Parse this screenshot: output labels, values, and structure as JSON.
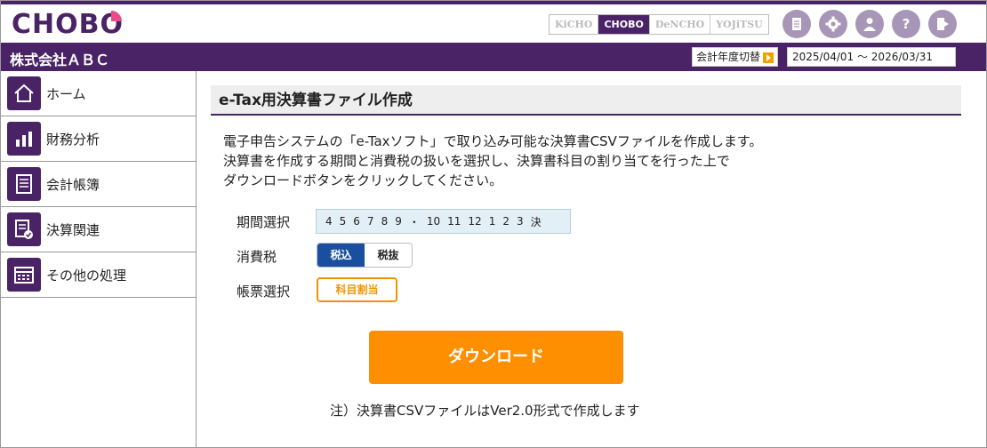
{
  "header": {
    "logo": "CHOBO",
    "apps": [
      "KiCHO",
      "CHOBO",
      "DeNCHO",
      "YOJiTSU"
    ],
    "active_app": "CHOBO",
    "icons": [
      "document-icon",
      "gear-icon",
      "user-icon",
      "help-icon",
      "logout-icon"
    ]
  },
  "band": {
    "company": "株式会社ＡＢＣ",
    "fy_switch_label": "会計年度切替",
    "fy_range": "2025/04/01 ～ 2026/03/31"
  },
  "sidebar": {
    "items": [
      {
        "label": "ホーム",
        "icon": "home-icon"
      },
      {
        "label": "財務分析",
        "icon": "bar-chart-icon"
      },
      {
        "label": "会計帳簿",
        "icon": "ledger-icon"
      },
      {
        "label": "決算関連",
        "icon": "settlement-icon"
      },
      {
        "label": "その他の処理",
        "icon": "calendar-icon"
      }
    ]
  },
  "main": {
    "title": "e-Tax用決算書ファイル作成",
    "desc": [
      "電子申告システムの「e-Taxソフト」で取り込み可能な決算書CSVファイルを作成します。",
      "決算書を作成する期間と消費税の扱いを選択し、決算書科目の割り当てを行った上で",
      "ダウンロードボタンをクリックしてください。"
    ],
    "period_label": "期間選択",
    "periods": [
      "4",
      "5",
      "6",
      "7",
      "8",
      "9",
      "・",
      "10",
      "11",
      "12",
      "1",
      "2",
      "3",
      "決"
    ],
    "tax_label": "消費税",
    "tax_options": [
      "税込",
      "税抜"
    ],
    "tax_selected": "税込",
    "form_label": "帳票選択",
    "assign_button": "科目割当",
    "download_button": "ダウンロード",
    "note": "注）決算書CSVファイルはVer2.0形式で作成します"
  },
  "colors": {
    "brand": "#4a2366",
    "accent_orange": "#fd8f00",
    "selected_blue": "#1a4fa0"
  }
}
